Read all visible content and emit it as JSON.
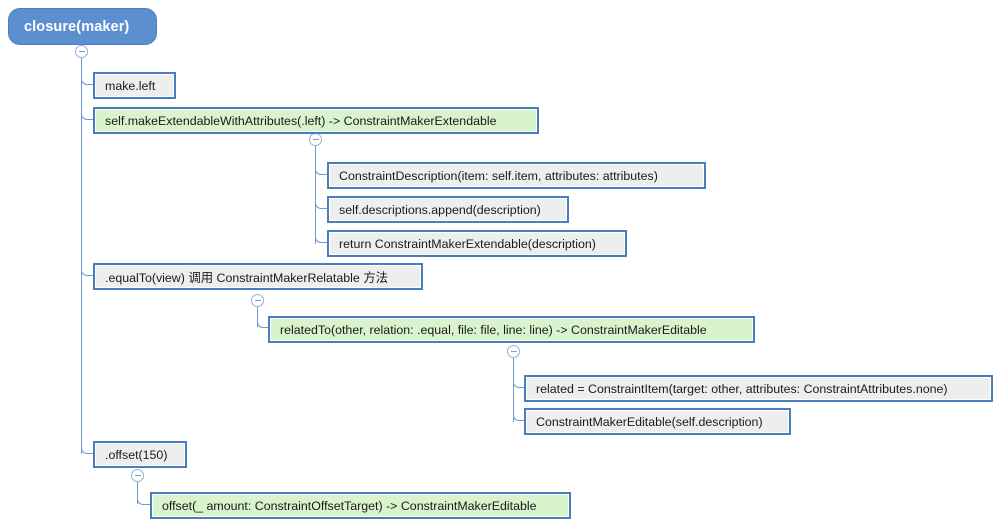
{
  "diagram": {
    "type": "mind-map-tree",
    "title": "closure(maker)",
    "colors": {
      "root_fill": "#5b8fd0",
      "node_border": "#4a7ebb",
      "node_fill_gray": "#eeeeee",
      "node_fill_green": "#d9f3cd",
      "connector": "#6e9bd2",
      "background": "#ffffff"
    },
    "toggle_icon": "collapse-minus-icon",
    "nodes": [
      {
        "id": "root",
        "label": "closure(maker)"
      },
      {
        "id": "n1",
        "label": "make.left"
      },
      {
        "id": "n2",
        "label": "self.makeExtendableWithAttributes(.left) -> ConstraintMakerExtendable"
      },
      {
        "id": "n2a",
        "label": "ConstraintDescription(item: self.item, attributes: attributes)"
      },
      {
        "id": "n2b",
        "label": "self.descriptions.append(description)"
      },
      {
        "id": "n2c",
        "label": "return ConstraintMakerExtendable(description)"
      },
      {
        "id": "n3",
        "label": ".equalTo(view) 调用 ConstraintMakerRelatable 方法"
      },
      {
        "id": "n3a",
        "label": "relatedTo(other, relation: .equal, file: file, line: line) -> ConstraintMakerEditable"
      },
      {
        "id": "n3a1",
        "label": "related = ConstraintItem(target: other, attributes: ConstraintAttributes.none)"
      },
      {
        "id": "n3a2",
        "label": "ConstraintMakerEditable(self.description)"
      },
      {
        "id": "n4",
        "label": ".offset(150)"
      },
      {
        "id": "n4a",
        "label": "offset(_ amount: ConstraintOffsetTarget) -> ConstraintMakerEditable"
      }
    ]
  }
}
